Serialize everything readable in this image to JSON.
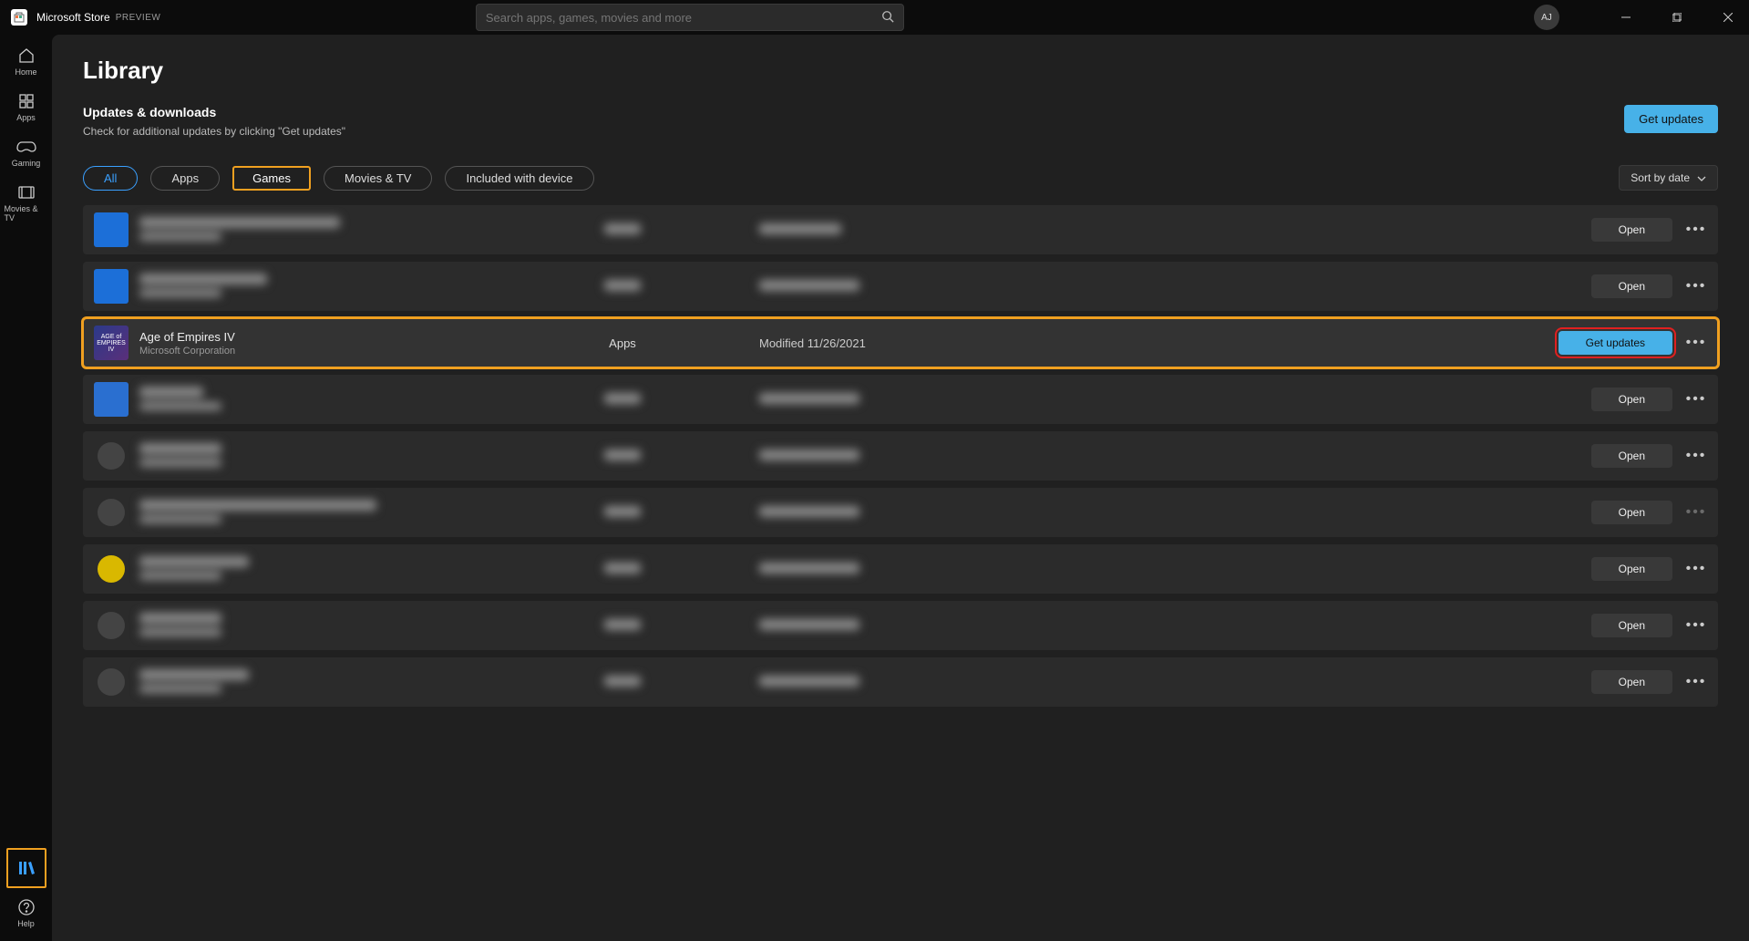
{
  "titlebar": {
    "app_name": "Microsoft Store",
    "preview_label": "PREVIEW",
    "avatar_initials": "AJ",
    "search_placeholder": "Search apps, games, movies and more"
  },
  "sidebar": {
    "home": "Home",
    "apps": "Apps",
    "gaming": "Gaming",
    "movies": "Movies & TV",
    "library": "Library",
    "help": "Help"
  },
  "page": {
    "title": "Library",
    "updates_heading": "Updates & downloads",
    "updates_sub": "Check for additional updates by clicking \"Get updates\"",
    "get_updates_button": "Get updates"
  },
  "tabs": {
    "all": "All",
    "apps": "Apps",
    "games": "Games",
    "movies": "Movies & TV",
    "included": "Included with device",
    "sort_label": "Sort by date"
  },
  "list": {
    "open_label": "Open",
    "get_updates_label": "Get updates",
    "highlighted": {
      "name": "Age of Empires IV",
      "publisher": "Microsoft Corporation",
      "category": "Apps",
      "modified": "Modified 11/26/2021",
      "thumb_text": "AGE of EMPIRES IV"
    }
  }
}
